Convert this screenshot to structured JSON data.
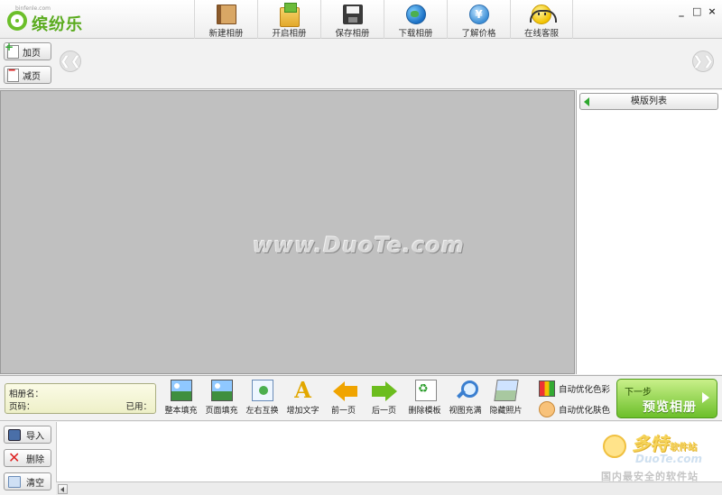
{
  "app": {
    "logo_text": "缤纷乐",
    "logo_url": "binfenle.com"
  },
  "toolbar": [
    {
      "label": "新建相册",
      "icon": "new-album-icon"
    },
    {
      "label": "开启相册",
      "icon": "open-album-icon"
    },
    {
      "label": "保存相册",
      "icon": "save-album-icon"
    },
    {
      "label": "下载相册",
      "icon": "download-album-icon"
    },
    {
      "label": "了解价格",
      "icon": "price-icon"
    },
    {
      "label": "在线客服",
      "icon": "customer-service-icon"
    }
  ],
  "window_controls": {
    "minimize": "_",
    "maximize": "□",
    "close": "×"
  },
  "page_controls": {
    "add_page": "加页",
    "remove_page": "减页"
  },
  "template_panel": {
    "title": "模版列表"
  },
  "canvas": {
    "watermark": "www.DuoTe.com"
  },
  "album_info": {
    "name_label": "相册名：",
    "page_label": "页码：",
    "used_label": "已用："
  },
  "edit_tools": [
    {
      "label": "整本填充",
      "icon": "fill-book-icon"
    },
    {
      "label": "页面填充",
      "icon": "fill-page-icon"
    },
    {
      "label": "左右互换",
      "icon": "swap-icon"
    },
    {
      "label": "增加文字",
      "icon": "add-text-icon"
    },
    {
      "label": "前一页",
      "icon": "prev-page-icon"
    },
    {
      "label": "后一页",
      "icon": "next-page-icon"
    },
    {
      "label": "删除模板",
      "icon": "delete-template-icon"
    },
    {
      "label": "视图充满",
      "icon": "zoom-fit-icon"
    },
    {
      "label": "隐藏照片",
      "icon": "hide-photo-icon"
    }
  ],
  "auto_optimize": {
    "color": "自动优化色彩",
    "skin": "自动优化肤色"
  },
  "next_step": {
    "line1": "下一步",
    "line2": "预览相册"
  },
  "photo_tools": {
    "import": "导入",
    "delete": "删除",
    "clear": "清空"
  },
  "footer_watermark": {
    "brand": "多特",
    "brand_suffix": "软件站",
    "domain": "DuoTe.com",
    "slogan": "国内最安全的软件站"
  },
  "colors": {
    "accent_green": "#6cbf2a",
    "canvas_gray": "#c0c0c0",
    "toolbar_bg": "#f2f2f2"
  }
}
